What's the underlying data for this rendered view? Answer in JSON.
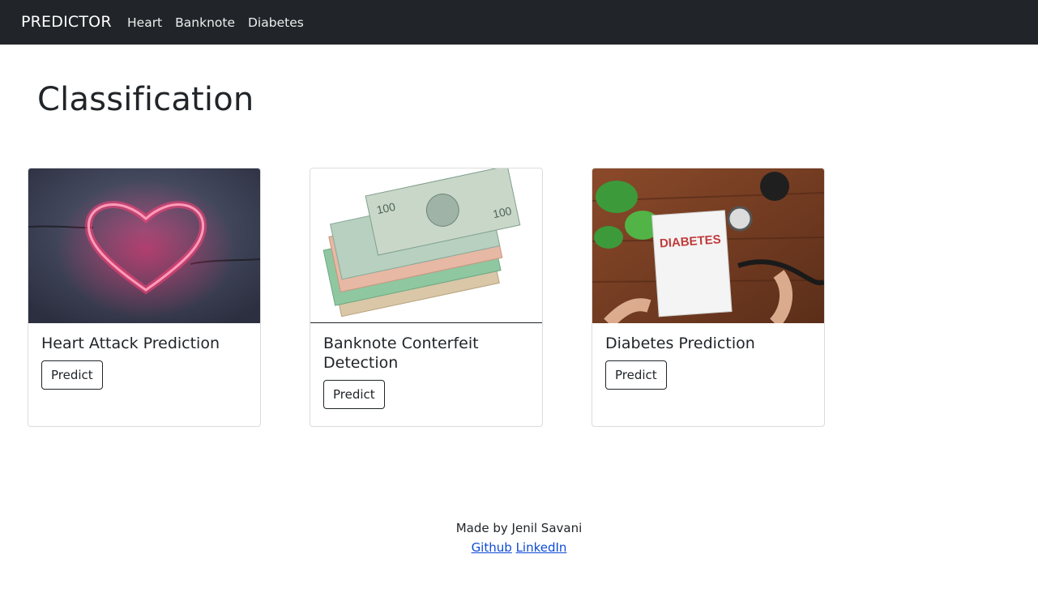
{
  "navbar": {
    "brand": "PREDICTOR",
    "links": [
      {
        "label": "Heart"
      },
      {
        "label": "Banknote"
      },
      {
        "label": "Diabetes"
      }
    ]
  },
  "page": {
    "title": "Classification"
  },
  "cards": [
    {
      "title": "Heart Attack Prediction",
      "button": "Predict",
      "image": "neon-heart-image"
    },
    {
      "title": "Banknote Conterfeit Detection",
      "button": "Predict",
      "image": "banknotes-image"
    },
    {
      "title": "Diabetes Prediction",
      "button": "Predict",
      "image": "diabetes-notebook-image"
    }
  ],
  "footer": {
    "made_by": "Made by Jenil Savani",
    "links": [
      {
        "label": "Github"
      },
      {
        "label": "LinkedIn"
      }
    ]
  },
  "colors": {
    "navbar": "#212529",
    "link": "#0d4ad6",
    "text": "#212529"
  }
}
